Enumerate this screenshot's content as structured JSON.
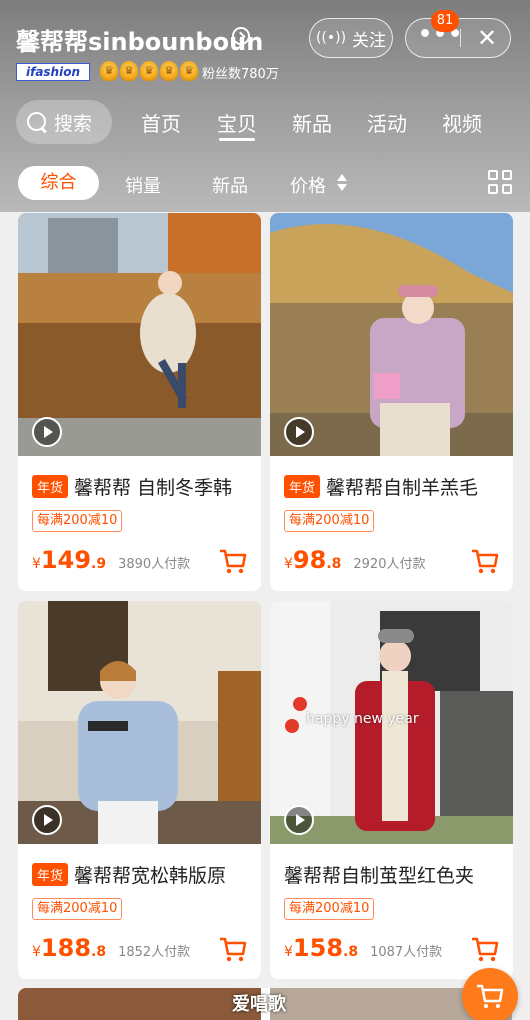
{
  "header": {
    "shop_name": "馨帮帮sinbounboun",
    "follow_label": "关注",
    "more_label": "•••",
    "close_label": "✕",
    "message_badge": "81",
    "ifashion_label": "ifashion",
    "crown_count": 5,
    "fans_text": "粉丝数780万"
  },
  "search": {
    "label": "搜索"
  },
  "nav_tabs": [
    {
      "label": "首页",
      "active": false
    },
    {
      "label": "宝贝",
      "active": true
    },
    {
      "label": "新品",
      "active": false
    },
    {
      "label": "活动",
      "active": false
    },
    {
      "label": "视频",
      "active": false
    }
  ],
  "filter_tabs": [
    {
      "label": "综合",
      "active": true
    },
    {
      "label": "销量",
      "active": false
    },
    {
      "label": "新品",
      "active": false
    },
    {
      "label": "价格",
      "active": false
    }
  ],
  "products": [
    {
      "tag": "年货",
      "title": "馨帮帮 自制冬季韩",
      "promo": "每满200减10",
      "price_symbol": "¥",
      "price_int": "149",
      "price_dec": ".9",
      "sold": "3890人付款"
    },
    {
      "tag": "年货",
      "title": "馨帮帮自制羊羔毛",
      "promo": "每满200减10",
      "price_symbol": "¥",
      "price_int": "98",
      "price_dec": ".8",
      "sold": "2920人付款"
    },
    {
      "tag": "年货",
      "title": "馨帮帮宽松韩版原",
      "promo": "每满200减10",
      "price_symbol": "¥",
      "price_int": "188",
      "price_dec": ".8",
      "sold": "1852人付款"
    },
    {
      "tag": "",
      "title": "馨帮帮自制茧型红色夹",
      "promo": "每满200减10",
      "price_symbol": "¥",
      "price_int": "158",
      "price_dec": ".8",
      "sold": "1087人付款",
      "image_caption": "happy new year"
    }
  ],
  "watermark": "爱唱歌",
  "colors": {
    "accent": "#ff5000",
    "header_bg": "#8c8c8c"
  }
}
